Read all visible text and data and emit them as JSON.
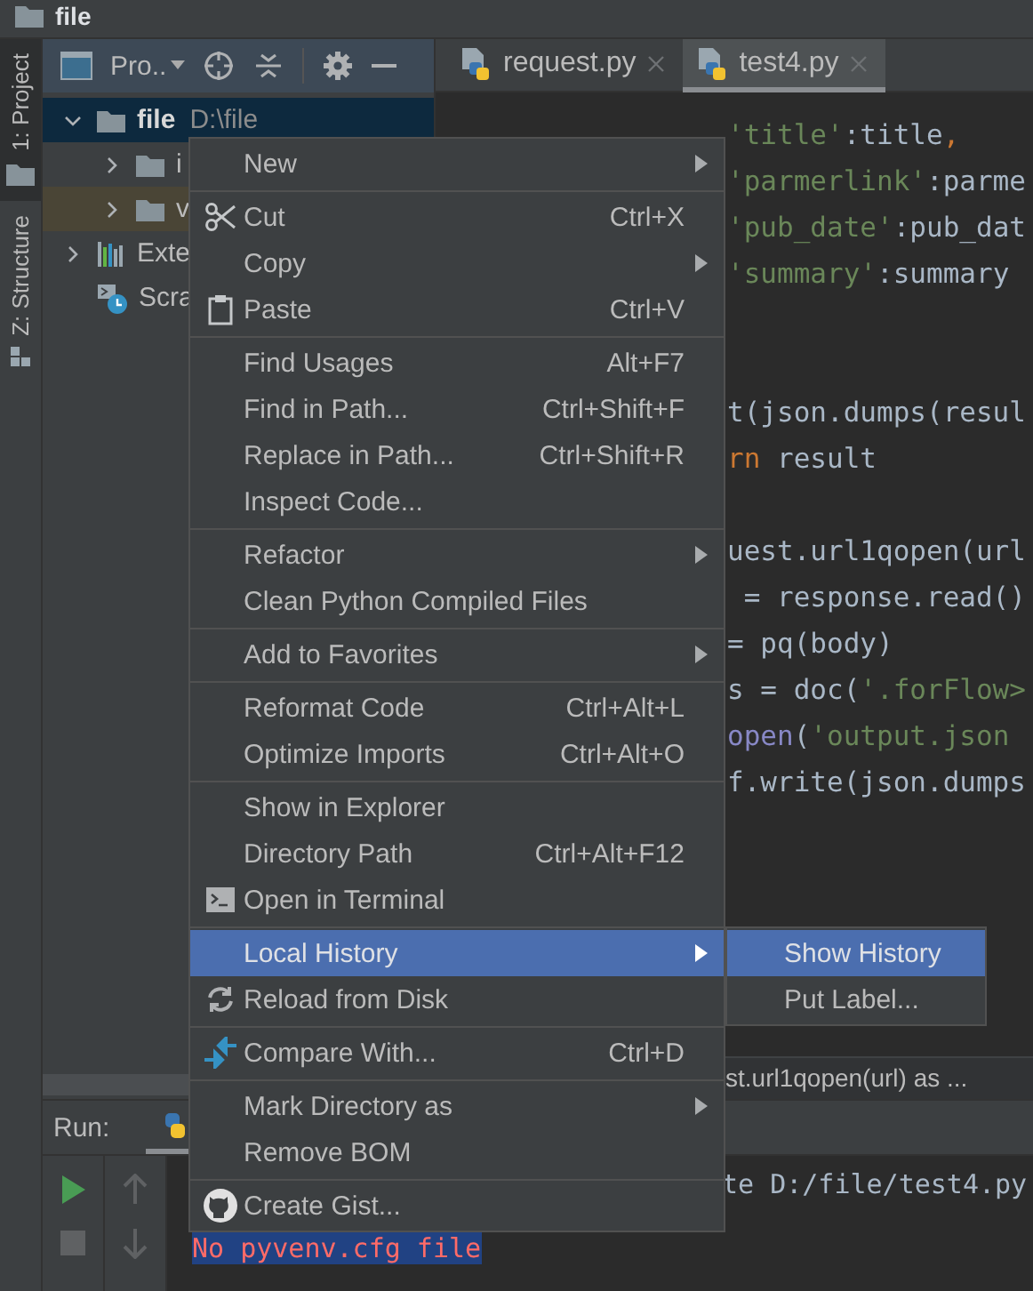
{
  "title_bar": {
    "title": "file"
  },
  "side_tabs": [
    {
      "label": "1: Project",
      "selected": true
    },
    {
      "label": "Z: Structure",
      "selected": false
    }
  ],
  "project": {
    "view_label": "Pro..",
    "tree": [
      {
        "label": "file",
        "path": "D:\\file",
        "kind": "folder",
        "expanded": true,
        "selected": true,
        "highlighted": false,
        "children": [
          {
            "label": "i",
            "kind": "folder",
            "expanded": false,
            "selected": false,
            "highlighted": false
          },
          {
            "label": "v",
            "kind": "folder",
            "expanded": false,
            "selected": false,
            "highlighted": true
          }
        ]
      },
      {
        "label": "Exte",
        "kind": "library",
        "expanded": false,
        "selected": false,
        "highlighted": false
      },
      {
        "label": "Scra",
        "kind": "scratch",
        "selected": false,
        "highlighted": false
      }
    ]
  },
  "editor": {
    "tabs": [
      {
        "label": "request.py",
        "selected": false
      },
      {
        "label": "test4.py",
        "selected": true
      }
    ],
    "lines": [
      {
        "kind": "code",
        "tokens": [
          {
            "text": "'title'",
            "kind": "string"
          },
          {
            "text": ":title",
            "kind": "plain"
          },
          {
            "text": ",",
            "kind": "keyword"
          }
        ]
      },
      {
        "kind": "code",
        "tokens": [
          {
            "text": "'parmerlink'",
            "kind": "string"
          },
          {
            "text": ":parme",
            "kind": "plain"
          }
        ]
      },
      {
        "kind": "code",
        "tokens": [
          {
            "text": "'pub_date'",
            "kind": "string"
          },
          {
            "text": ":pub_dat",
            "kind": "plain"
          }
        ]
      },
      {
        "kind": "code",
        "tokens": [
          {
            "text": "'summary'",
            "kind": "string"
          },
          {
            "text": ":summary",
            "kind": "plain"
          }
        ]
      },
      {
        "kind": "blank"
      },
      {
        "kind": "blank"
      },
      {
        "kind": "code",
        "tokens": [
          {
            "text": "t(json.dumps(resul",
            "kind": "plain"
          }
        ]
      },
      {
        "kind": "code",
        "tokens": [
          {
            "text": "rn",
            "kind": "keyword"
          },
          {
            "text": " result",
            "kind": "plain"
          }
        ]
      },
      {
        "kind": "blank"
      },
      {
        "kind": "code",
        "tokens": [
          {
            "text": "uest.url1qopen(url",
            "kind": "plain"
          }
        ]
      },
      {
        "kind": "code",
        "tokens": [
          {
            "text": " = response.read()",
            "kind": "plain"
          }
        ]
      },
      {
        "kind": "code",
        "tokens": [
          {
            "text": "= pq(body)",
            "kind": "plain"
          }
        ]
      },
      {
        "kind": "code",
        "tokens": [
          {
            "text": "s = doc(",
            "kind": "plain"
          },
          {
            "text": "'.forFlow>",
            "kind": "string"
          }
        ]
      },
      {
        "kind": "code",
        "tokens": [
          {
            "text": "open",
            "kind": "builtin"
          },
          {
            "text": "(",
            "kind": "plain"
          },
          {
            "text": "'output.json",
            "kind": "string"
          }
        ]
      },
      {
        "kind": "code",
        "tokens": [
          {
            "text": "f.write(json.dumps",
            "kind": "plain"
          }
        ]
      }
    ],
    "breadcrumb": "st.url1qopen(url) as ..."
  },
  "run": {
    "label": "Run:",
    "console": [
      {
        "text": "te D:/file/test4.py",
        "kind": "normal"
      },
      {
        "text": "No pyvenv.cfg file",
        "kind": "error"
      }
    ]
  },
  "context_menu": {
    "groups": [
      [
        {
          "label": "New",
          "submenu": true,
          "selected": false
        }
      ],
      [
        {
          "label": "Cut",
          "shortcut": "Ctrl+X",
          "kind": "scissors",
          "submenu": false,
          "selected": false
        },
        {
          "label": "Copy",
          "submenu": true,
          "selected": false
        },
        {
          "label": "Paste",
          "shortcut": "Ctrl+V",
          "kind": "clipboard",
          "submenu": false,
          "selected": false
        }
      ],
      [
        {
          "label": "Find Usages",
          "shortcut": "Alt+F7",
          "submenu": false,
          "selected": false
        },
        {
          "label": "Find in Path...",
          "shortcut": "Ctrl+Shift+F",
          "submenu": false,
          "selected": false
        },
        {
          "label": "Replace in Path...",
          "shortcut": "Ctrl+Shift+R",
          "submenu": false,
          "selected": false
        },
        {
          "label": "Inspect Code...",
          "submenu": false,
          "selected": false
        }
      ],
      [
        {
          "label": "Refactor",
          "submenu": true,
          "selected": false
        },
        {
          "label": "Clean Python Compiled Files",
          "submenu": false,
          "selected": false
        }
      ],
      [
        {
          "label": "Add to Favorites",
          "submenu": true,
          "selected": false
        }
      ],
      [
        {
          "label": "Reformat Code",
          "shortcut": "Ctrl+Alt+L",
          "submenu": false,
          "selected": false
        },
        {
          "label": "Optimize Imports",
          "shortcut": "Ctrl+Alt+O",
          "submenu": false,
          "selected": false
        }
      ],
      [
        {
          "label": "Show in Explorer",
          "submenu": false,
          "selected": false
        },
        {
          "label": "Directory Path",
          "shortcut": "Ctrl+Alt+F12",
          "submenu": false,
          "selected": false
        },
        {
          "label": "Open in Terminal",
          "kind": "terminal",
          "submenu": false,
          "selected": false
        }
      ],
      [
        {
          "label": "Local History",
          "submenu": true,
          "selected": true
        },
        {
          "label": "Reload from Disk",
          "kind": "refresh",
          "submenu": false,
          "selected": false
        }
      ],
      [
        {
          "label": "Compare With...",
          "shortcut": "Ctrl+D",
          "kind": "compare",
          "submenu": false,
          "selected": false
        }
      ],
      [
        {
          "label": "Mark Directory as",
          "submenu": true,
          "selected": false
        },
        {
          "label": "Remove BOM",
          "submenu": false,
          "selected": false
        }
      ],
      [
        {
          "label": "Create Gist...",
          "kind": "cat",
          "submenu": false,
          "selected": false
        }
      ]
    ]
  },
  "submenu": {
    "items": [
      {
        "label": "Show History",
        "selected": true
      },
      {
        "label": "Put Label...",
        "selected": false
      }
    ]
  }
}
